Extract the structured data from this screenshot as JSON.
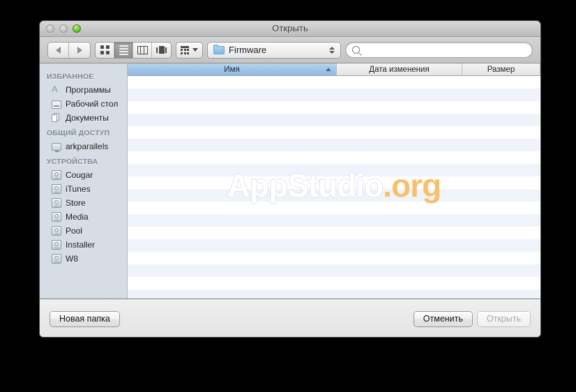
{
  "window": {
    "title": "Открыть",
    "traffic_lights": [
      {
        "name": "close",
        "state": "inactive"
      },
      {
        "name": "minimize",
        "state": "inactive"
      },
      {
        "name": "zoom",
        "state": "active",
        "color": "#6ec738"
      }
    ]
  },
  "toolbar": {
    "nav": {
      "back": "back-arrow",
      "forward": "forward-arrow"
    },
    "view_modes": [
      {
        "name": "icon-view",
        "icon": "grid-icon",
        "selected": false
      },
      {
        "name": "list-view",
        "icon": "list-icon",
        "selected": true
      },
      {
        "name": "column-view",
        "icon": "columns-icon",
        "selected": false
      },
      {
        "name": "coverflow-view",
        "icon": "coverflow-icon",
        "selected": false
      }
    ],
    "action_menu": {
      "icon": "action-gear-icon",
      "caret": "chevron-down-icon"
    },
    "path_popup": {
      "icon": "folder-icon",
      "label": "Firmware",
      "stepper": "up-down-stepper-icon"
    },
    "search": {
      "icon": "search-icon",
      "value": "",
      "placeholder": ""
    }
  },
  "sidebar": {
    "sections": [
      {
        "header": "ИЗБРАННОЕ",
        "items": [
          {
            "label": "Программы",
            "icon": "applications-icon"
          },
          {
            "label": "Рабочий стол",
            "icon": "desktop-icon"
          },
          {
            "label": "Документы",
            "icon": "documents-icon"
          }
        ]
      },
      {
        "header": "ОБЩИЙ ДОСТУП",
        "items": [
          {
            "label": "arkparallels",
            "icon": "shared-computer-icon"
          }
        ]
      },
      {
        "header": "УСТРОЙСТВА",
        "items": [
          {
            "label": "Cougar",
            "icon": "hard-drive-icon"
          },
          {
            "label": "iTunes",
            "icon": "hard-drive-icon"
          },
          {
            "label": "Store",
            "icon": "hard-drive-icon"
          },
          {
            "label": "Media",
            "icon": "hard-drive-icon"
          },
          {
            "label": "Pool",
            "icon": "hard-drive-icon"
          },
          {
            "label": "Installer",
            "icon": "hard-drive-icon"
          },
          {
            "label": "W8",
            "icon": "hard-drive-icon"
          }
        ]
      }
    ]
  },
  "file_list": {
    "columns": [
      {
        "label": "Имя",
        "sorted": true,
        "sort_direction": "ascending"
      },
      {
        "label": "Дата изменения",
        "sorted": false
      },
      {
        "label": "Размер",
        "sorted": false
      }
    ],
    "rows": [],
    "row_count_visible": 18,
    "empty": true,
    "stripe_color": "#f0f4fa"
  },
  "watermark": {
    "main": "AppStudio",
    "suffix": ".org",
    "suffix_color": "#f7c06a"
  },
  "footer": {
    "new_folder_label": "Новая папка",
    "cancel_label": "Отменить",
    "open_label": "Открыть",
    "open_disabled": true
  }
}
